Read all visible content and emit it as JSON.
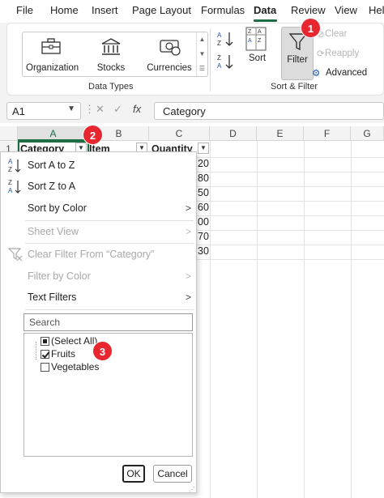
{
  "menu": [
    "File",
    "Home",
    "Insert",
    "Page Layout",
    "Formulas",
    "Data",
    "Review",
    "View",
    "Help"
  ],
  "active_tab": "Data",
  "ribbon": {
    "data_types": {
      "items": [
        "Organization",
        "Stocks",
        "Currencies"
      ],
      "label": "Data Types"
    },
    "sort_filter": {
      "sort_az": "A↓Z",
      "sort_za": "Z↓A",
      "sort": "Sort",
      "filter": "Filter",
      "clear": "Clear",
      "reapply": "Reapply",
      "advanced": "Advanced",
      "label": "Sort & Filter"
    }
  },
  "formula_bar": {
    "name_box": "A1",
    "fx": "fx",
    "value": "Category"
  },
  "columns": [
    "A",
    "B",
    "C",
    "D",
    "E",
    "F",
    "G"
  ],
  "row_numbers": [
    "1"
  ],
  "header_row": [
    "Category",
    "Item",
    "Quantity"
  ],
  "quantity_values": [
    "20",
    "80",
    "50",
    "60",
    "00",
    "70",
    "30"
  ],
  "popup": {
    "items": [
      {
        "label": "Sort A to Z",
        "icon": "A↓Z"
      },
      {
        "label": "Sort Z to A",
        "icon": "Z↓A"
      },
      {
        "label": "Sort by Color",
        "arrow": ">"
      },
      {
        "label": "Sheet View",
        "arrow": ">"
      },
      {
        "label": "Clear Filter From “Category”"
      },
      {
        "label": "Filter by Color",
        "arrow": ">"
      },
      {
        "label": "Text Filters",
        "arrow": ">"
      }
    ],
    "search_placeholder": "Search",
    "list": [
      {
        "label": "(Select All)",
        "state": "mixed"
      },
      {
        "label": "Fruits",
        "state": "checked"
      },
      {
        "label": "Vegetables",
        "state": "unchecked"
      }
    ],
    "ok": "OK",
    "cancel": "Cancel"
  },
  "badges": [
    "1",
    "2",
    "3"
  ],
  "colors": {
    "accent": "#1f6e43",
    "badge": "#e8262f"
  }
}
